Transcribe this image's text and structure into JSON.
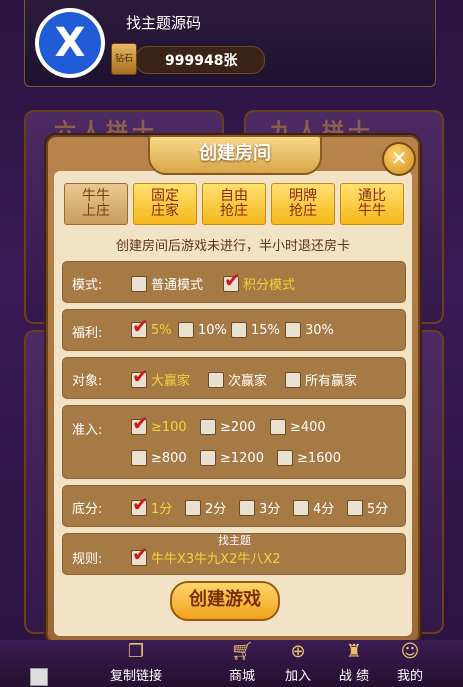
{
  "header": {
    "username": "找主题源码",
    "card_count": "999948张",
    "card_icon_label": "钻石",
    "avatar": "logo"
  },
  "background": {
    "left_title": "六人拼十",
    "right_title": "九人拼十"
  },
  "modal": {
    "title": "创建房间",
    "tabs": [
      {
        "label": "牛牛\n上庄"
      },
      {
        "label": "固定\n庄家"
      },
      {
        "label": "自由\n抢庄"
      },
      {
        "label": "明牌\n抢庄"
      },
      {
        "label": "通比\n牛牛"
      }
    ],
    "notice": "创建房间后游戏未进行，半小时退还房卡",
    "rows": {
      "mode": {
        "label": "模式:",
        "options": [
          "普通模式",
          "积分模式"
        ]
      },
      "welfare": {
        "label": "福利:",
        "options": [
          "5%",
          "10%",
          "15%",
          "30%"
        ]
      },
      "target": {
        "label": "对象:",
        "options": [
          "大赢家",
          "次赢家",
          "所有赢家"
        ]
      },
      "entry": {
        "label": "准入:",
        "options": [
          "≥100",
          "≥200",
          "≥400",
          "≥800",
          "≥1200",
          "≥1600"
        ]
      },
      "base": {
        "label": "底分:",
        "options": [
          "1分",
          "2分",
          "3分",
          "4分",
          "5分"
        ]
      },
      "rule": {
        "label": "规则:",
        "options": [
          "牛牛X3牛九X2牛八X2"
        ],
        "tag": "找主题"
      }
    },
    "create_button": "创建游戏"
  },
  "nav": [
    {
      "label": "复制链接",
      "icon": "copy-icon"
    },
    {
      "label": "商城",
      "icon": "cart-icon"
    },
    {
      "label": "加入",
      "icon": "join-icon"
    },
    {
      "label": "战 绩",
      "icon": "trophy-icon"
    },
    {
      "label": "我的",
      "icon": "user-icon"
    }
  ]
}
